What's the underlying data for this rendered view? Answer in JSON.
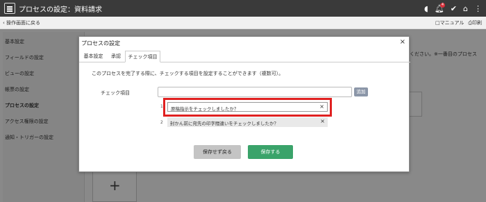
{
  "topbar": {
    "title": "プロセスの設定：資料請求",
    "notification_count": "4",
    "icons": [
      "shield-icon",
      "bell-icon",
      "check-icon",
      "home-icon",
      "more-icon"
    ]
  },
  "subbar": {
    "back": "‹ 操作画面に戻る",
    "manual": "□マニュアル",
    "print": "⎙印刷"
  },
  "sidebar": {
    "items": [
      {
        "label": "基本設定"
      },
      {
        "label": "フィールドの設定"
      },
      {
        "label": "ビューの設定"
      },
      {
        "label": "帳票の設定"
      },
      {
        "label": "プロセスの設定"
      },
      {
        "label": "アクセス権限の設定"
      },
      {
        "label": "通知・トリガーの設定"
      }
    ]
  },
  "background": {
    "note": "ください。※一番目のプロセス",
    "plus": "+"
  },
  "dialog": {
    "title": "プロセスの設定",
    "close": "×",
    "tabs": [
      {
        "label": "基本設定"
      },
      {
        "label": "承認"
      },
      {
        "label": "チェック項目"
      }
    ],
    "description": "このプロセスを完了する際に、チェックする項目を設定することができます（複数可）。",
    "field_label": "チェック項目",
    "field_value": "",
    "add_label": "追加",
    "items": [
      {
        "num": "1",
        "text": "原稿指示をチェックしましたか？",
        "remove": "×"
      },
      {
        "num": "2",
        "text": "封かん前に宛先の印字間違いをチェックしましたか？",
        "remove": "×"
      }
    ],
    "cancel_label": "保存せず戻る",
    "save_label": "保存する"
  },
  "colors": {
    "topbar": "#3a3a3a",
    "save": "#3aa36a",
    "highlight": "#e02020",
    "badge": "#d9303b"
  }
}
